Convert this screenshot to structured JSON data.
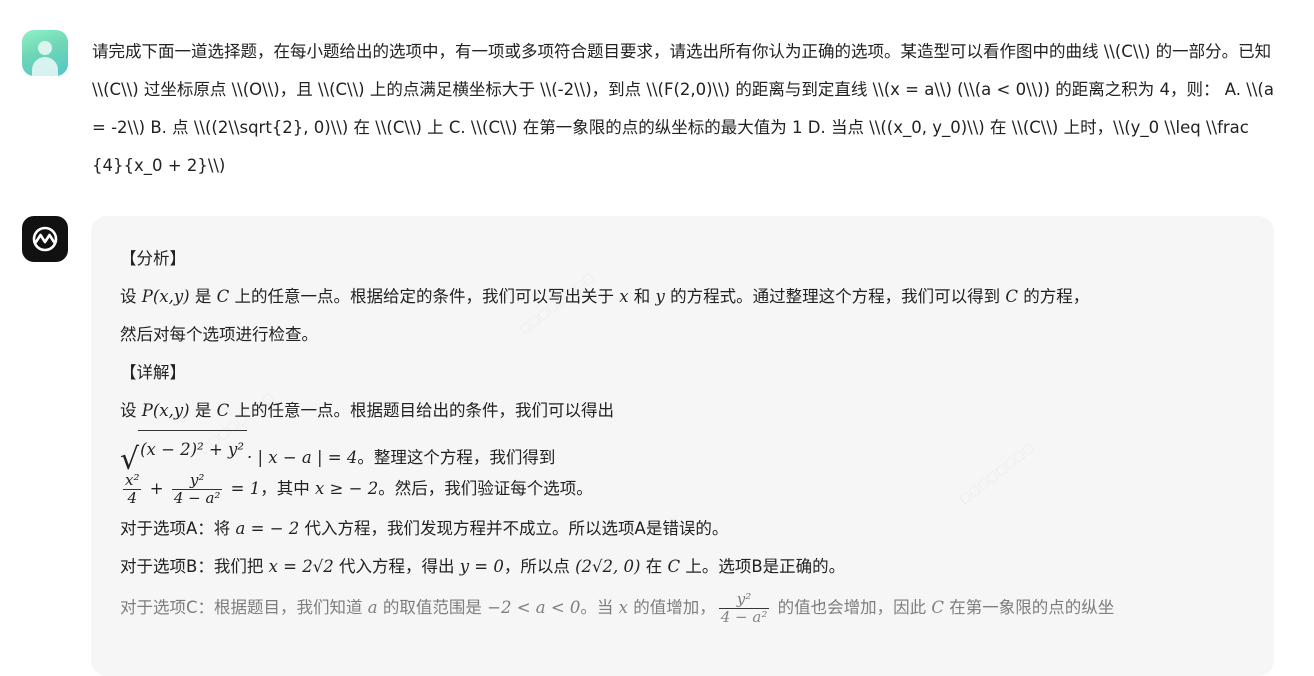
{
  "conversation": {
    "user": {
      "avatar_icon": "user-avatar-icon",
      "question": "请完成下面一道选择题，在每小题给出的选项中，有一项或多项符合题目要求，请选出所有你认为正确的选项。某造型可以看作图中的曲线 \\\\(C\\\\) 的一部分。已知 \\\\(C\\\\) 过坐标原点 \\\\(O\\\\)，且 \\\\(C\\\\) 上的点满足横坐标大于 \\\\(-2\\\\)，到点 \\\\(F(2,0)\\\\) 的距离与到定直线 \\\\(x = a\\\\) (\\\\(a < 0\\\\)) 的距离之积为 4，则： A. \\\\(a = -2\\\\) B. 点 \\\\((2\\\\sqrt{2}, 0)\\\\) 在 \\\\(C\\\\) 上 C. \\\\(C\\\\) 在第一象限的点的纵坐标的最大值为 1 D. 当点 \\\\((x_0, y_0)\\\\) 在 \\\\(C\\\\) 上时，\\\\(y_0 \\\\leq \\\\frac{4}{x_0 + 2}\\\\)"
    },
    "assistant": {
      "avatar_icon": "assistant-logo-icon",
      "analysis_heading": "【分析】",
      "analysis_text": {
        "p1": "设 ",
        "m1": "P(x,y)",
        "p2": " 是 ",
        "m2": "C",
        "p3": " 上的任意一点。根据给定的条件，我们可以写出关于 ",
        "m3": "x",
        "p4": " 和 ",
        "m4": "y",
        "p5": " 的方程式。通过整理这个方程，我们可以得到 ",
        "m5": "C",
        "p6": " 的方程，",
        "p7": "然后对每个选项进行检查。"
      },
      "detail_heading": "【详解】",
      "detail_line1": {
        "p1": "设 ",
        "m1": "P(x,y)",
        "p2": " 是 ",
        "m2": "C",
        "p3": " 上的任意一点。根据题目给出的条件，我们可以得出"
      },
      "detail_line2": {
        "radicand": "(x − 2)² + y²",
        "rest": "· | x − a |  = 4",
        "text": "。整理这个方程，我们得到"
      },
      "detail_line3": {
        "frac1_num": "x²",
        "frac1_den": "4",
        "plus": " + ",
        "frac2_num": "y²",
        "frac2_den": "4 − a²",
        "eq": " = 1",
        "p1": "，其中 ",
        "m1": "x ≥ − 2",
        "p2": "。然后，我们验证每个选项。"
      },
      "option_a": {
        "p1": "对于选项A：将 ",
        "m1": "a = − 2",
        "p2": " 代入方程，我们发现方程并不成立。所以选项A是错误的。"
      },
      "option_b": {
        "p1": "对于选项B：我们把 ",
        "m1": "x = 2√2",
        "p2": " 代入方程，得出 ",
        "m2": "y = 0",
        "p3": "，所以点 ",
        "m3": "(2√2, 0)",
        "p4": " 在 ",
        "m4": "C",
        "p5": " 上。选项B是正确的。"
      },
      "option_c": {
        "p1": "对于选项C：根据题目，我们知道 ",
        "m1": "a",
        "p2": " 的取值范围是 ",
        "m2": "−2 < a < 0",
        "p3": "。当 ",
        "m3": "x",
        "p4": " 的值增加，",
        "frac_num": "y²",
        "frac_den": "4 − a²",
        "p5": " 的值也会增加，因此 ",
        "m4": "C",
        "p6": " 在第一象限的点的纵坐"
      }
    }
  },
  "colors": {
    "user_avatar": "#6fd6b6",
    "assistant_avatar": "#111111",
    "answer_background": "#f6f6f7"
  }
}
